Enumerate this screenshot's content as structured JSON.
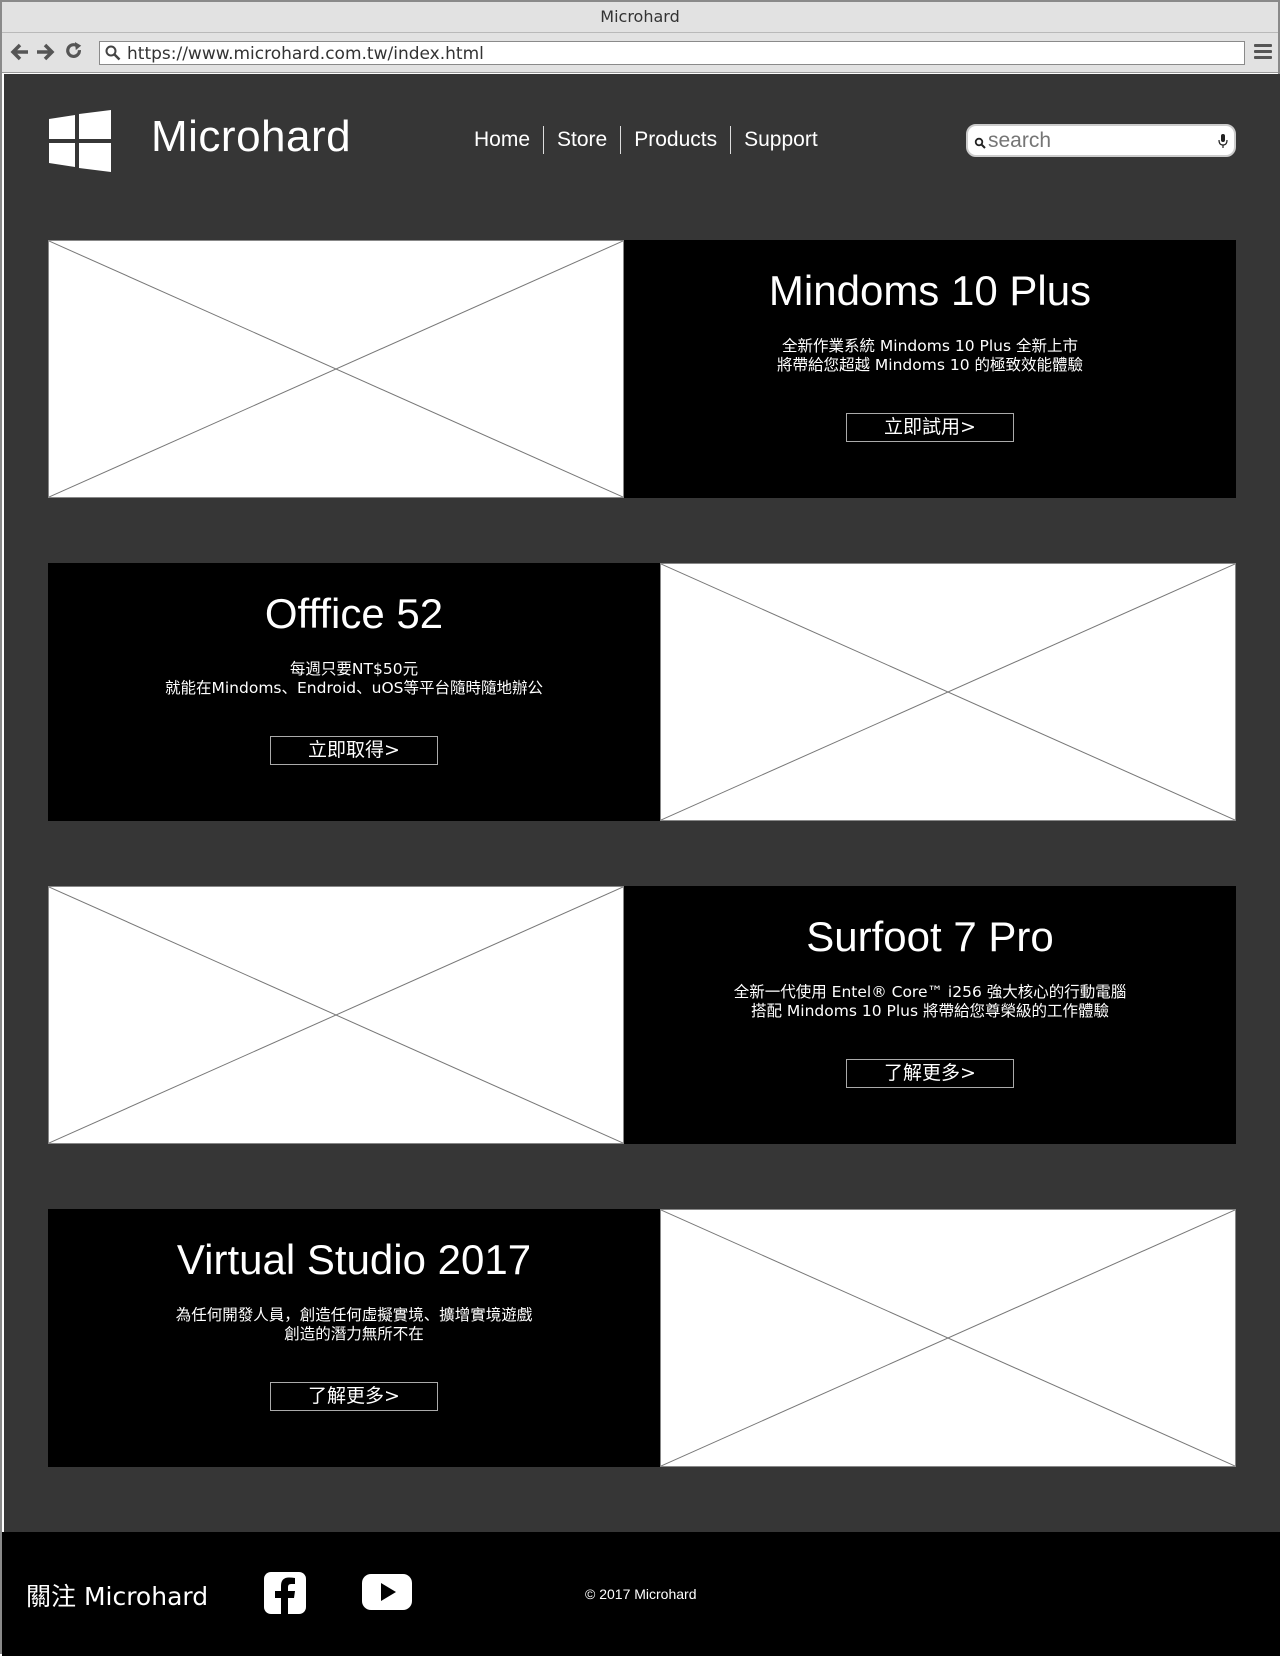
{
  "browser": {
    "window_title": "Microhard",
    "url": "https://www.microhard.com.tw/index.html"
  },
  "header": {
    "brand": "Microhard",
    "nav": [
      "Home",
      "Store",
      "Products",
      "Support"
    ],
    "search_placeholder": "search"
  },
  "promos": [
    {
      "title": "Mindoms 10 Plus",
      "desc_line1": "全新作業系統 Mindoms 10 Plus 全新上市",
      "desc_line2": "將帶給您超越 Mindoms 10 的極致效能體驗",
      "button": "立即試用>"
    },
    {
      "title": "Offfice 52",
      "desc_line1": "每週只要NT$50元",
      "desc_line2": "就能在Mindoms、Endroid、uOS等平台隨時隨地辦公",
      "button": "立即取得>"
    },
    {
      "title": "Surfoot 7 Pro",
      "desc_line1": "全新一代使用 Entel® Core™ i256 強大核心的行動電腦",
      "desc_line2": "搭配 Mindoms 10 Plus 將帶給您尊榮級的工作體驗",
      "button": "了解更多>"
    },
    {
      "title": "Virtual Studio 2017",
      "desc_line1": "為任何開發人員，創造任何虛擬實境、擴增實境遊戲",
      "desc_line2": "創造的潛力無所不在",
      "button": "了解更多>"
    }
  ],
  "footer": {
    "follow": "關注 Microhard",
    "copyright": "© 2017 Microhard"
  }
}
